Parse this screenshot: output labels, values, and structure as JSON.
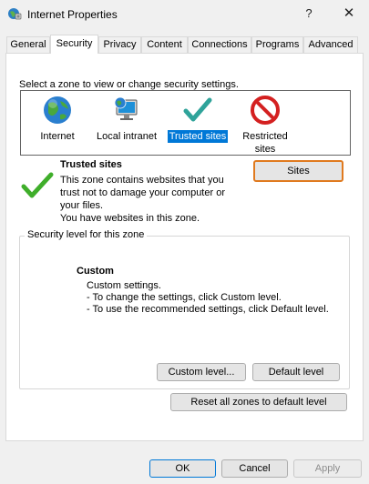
{
  "window": {
    "title": "Internet Properties",
    "help_glyph": "?",
    "close_glyph": "✕"
  },
  "tabs": [
    {
      "label": "General"
    },
    {
      "label": "Security"
    },
    {
      "label": "Privacy"
    },
    {
      "label": "Content"
    },
    {
      "label": "Connections"
    },
    {
      "label": "Programs"
    },
    {
      "label": "Advanced"
    }
  ],
  "active_tab": "Security",
  "security": {
    "zone_prompt": "Select a zone to view or change security settings.",
    "zones": [
      {
        "label": "Internet",
        "icon": "globe-icon"
      },
      {
        "label": "Local intranet",
        "icon": "monitor-globe-icon"
      },
      {
        "label": "Trusted sites",
        "icon": "checkmark-icon",
        "selected": true
      },
      {
        "label_line1": "Restricted",
        "label_line2": "sites",
        "icon": "no-entry-icon"
      }
    ],
    "zone_info": {
      "title": "Trusted sites",
      "desc_line1": "This zone contains websites that you",
      "desc_line2": "trust not to damage your computer or",
      "desc_line3": "your files.",
      "desc_line4": "You have websites in this zone."
    },
    "sites_button": "Sites",
    "level_group": {
      "title": "Security level for this zone",
      "level_name": "Custom",
      "line1": "Custom settings.",
      "line2": "- To change the settings, click Custom level.",
      "line3": "- To use the recommended settings, click Default level."
    },
    "custom_level_button": "Custom level...",
    "default_level_button": "Default level",
    "reset_button": "Reset all zones to default level"
  },
  "footer": {
    "ok": "OK",
    "cancel": "Cancel",
    "apply": "Apply"
  },
  "colors": {
    "selection": "#0078d7",
    "focus_ring": "#e07a1f",
    "check_green": "#3fae2a"
  }
}
